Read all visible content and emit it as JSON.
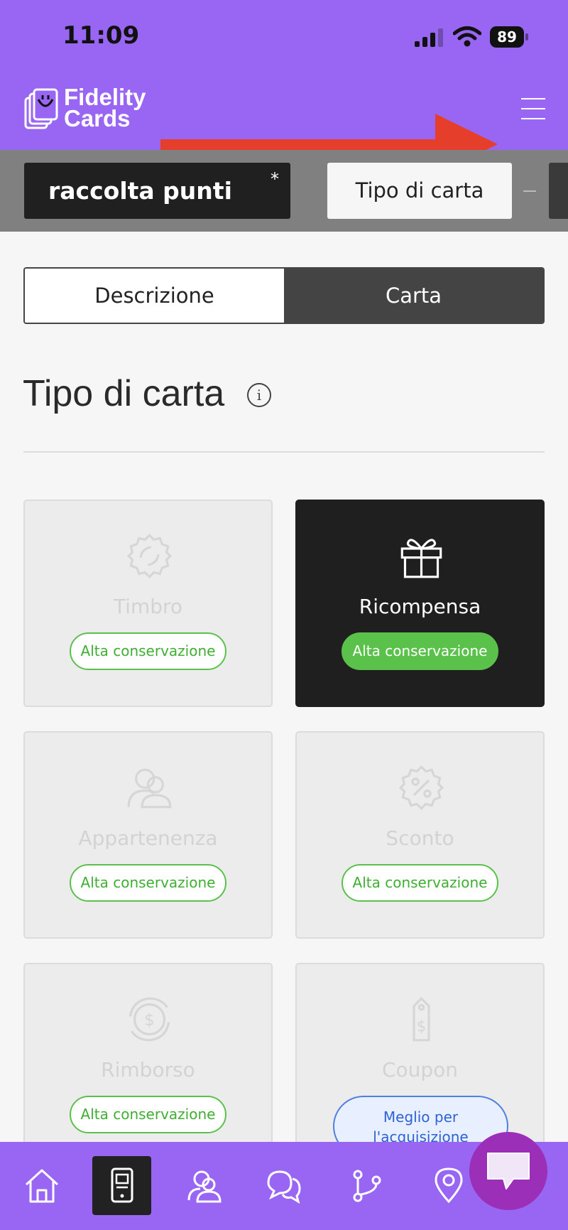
{
  "status_bar": {
    "time": "11:09",
    "battery": "89"
  },
  "header": {
    "logo_line1": "Fidelity",
    "logo_line2": "Cards"
  },
  "card_bar": {
    "card_name": "raccolta punti",
    "required_mark": "*",
    "type_button": "Tipo di carta"
  },
  "tabs": [
    {
      "label": "Descrizione",
      "active": true
    },
    {
      "label": "Carta",
      "active": false
    }
  ],
  "section": {
    "title": "Tipo di carta"
  },
  "card_types": [
    {
      "label": "Timbro",
      "badge": "Alta conservazione",
      "icon": "stamp-icon",
      "selected": false
    },
    {
      "label": "Ricompensa",
      "badge": "Alta conservazione",
      "icon": "gift-icon",
      "selected": true
    },
    {
      "label": "Appartenenza",
      "badge": "Alta conservazione",
      "icon": "membership-icon",
      "selected": false
    },
    {
      "label": "Sconto",
      "badge": "Alta conservazione",
      "icon": "discount-icon",
      "selected": false
    },
    {
      "label": "Rimborso",
      "badge": "Alta conservazione",
      "icon": "cashback-icon",
      "selected": false
    },
    {
      "label": "Coupon",
      "badge": "Meglio per l'acquisizione",
      "icon": "coupon-icon",
      "selected": false
    }
  ],
  "bottom_nav": [
    {
      "icon": "home-icon"
    },
    {
      "icon": "card-device-icon",
      "active": true
    },
    {
      "icon": "customers-icon"
    },
    {
      "icon": "messages-icon"
    },
    {
      "icon": "automation-icon"
    },
    {
      "icon": "location-icon"
    }
  ],
  "colors": {
    "brand": "#9966f4",
    "badge_green": "#5ac24a",
    "badge_blue": "#4f7fe0",
    "chat": "#9b2fb8",
    "annotation_arrow": "#e53e2b"
  }
}
